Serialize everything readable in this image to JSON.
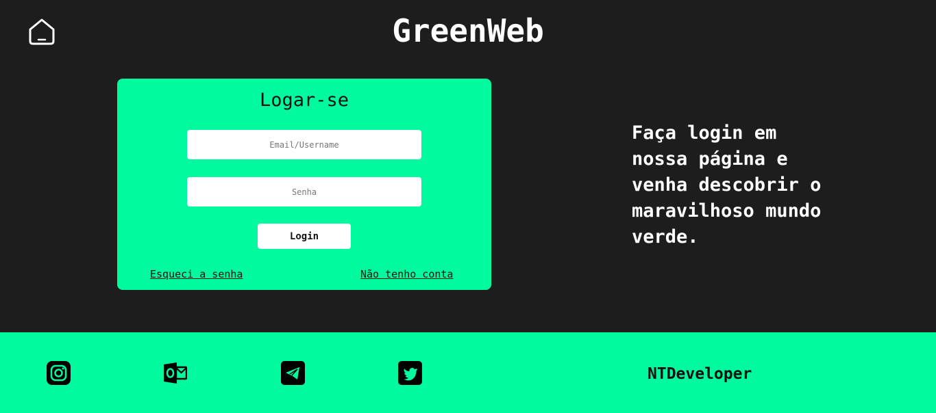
{
  "header": {
    "title": "GreenWeb",
    "home_icon": "home-icon"
  },
  "login": {
    "title": "Logar-se",
    "email_placeholder": "Email/Username",
    "password_placeholder": "Senha",
    "submit_label": "Login",
    "forgot_link": "Esqueci a senha",
    "signup_link": "Não tenho conta"
  },
  "promo": {
    "text": "Faça login em nossa página e venha descobrir o maravilhoso mundo verde."
  },
  "footer": {
    "social_icons": [
      "instagram-icon",
      "outlook-icon",
      "telegram-icon",
      "twitter-icon"
    ],
    "credit": "NTDeveloper"
  },
  "colors": {
    "background": "#1d1d1d",
    "accent": "#00fa9d",
    "text_light": "#ffffff",
    "text_dark": "#111111"
  }
}
